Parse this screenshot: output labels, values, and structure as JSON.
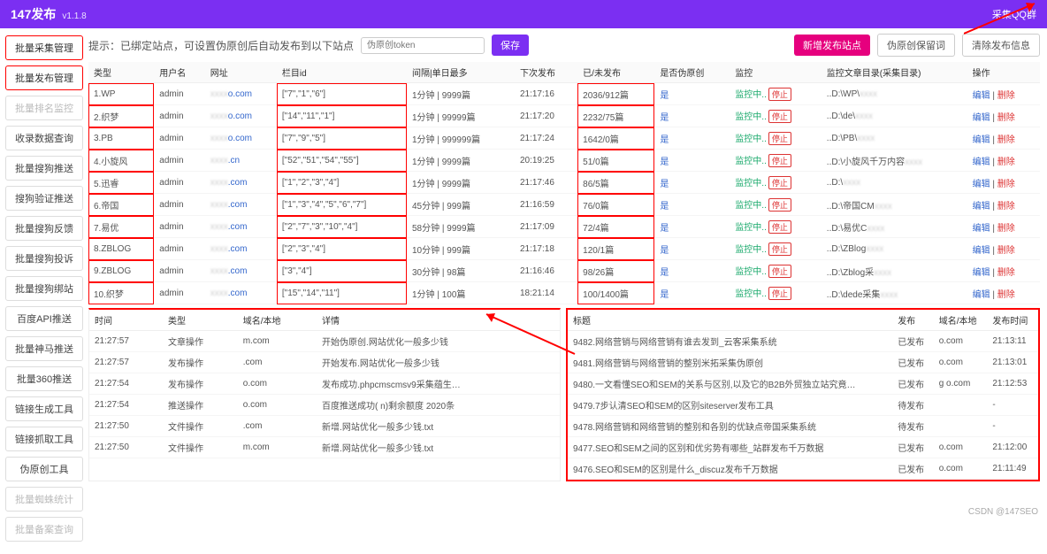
{
  "app": {
    "title": "147发布",
    "version": "v1.1.8",
    "qqgroup": "采集QQ群"
  },
  "sidebar": {
    "items": [
      "批量采集管理",
      "批量发布管理",
      "批量排名监控",
      "收录数据查询",
      "批量搜狗推送",
      "搜狗验证推送",
      "批量搜狗反馈",
      "批量搜狗投诉",
      "批量搜狗绑站",
      "百度API推送",
      "批量神马推送",
      "批量360推送",
      "链接生成工具",
      "链接抓取工具",
      "伪原创工具",
      "批量蜘蛛统计",
      "批量备案查询"
    ]
  },
  "tip": "提示：已绑定站点，可设置伪原创后自动发布到以下站点",
  "token_ph": "伪原创token",
  "buttons": {
    "save": "保存",
    "add": "新增发布站点",
    "fake": "伪原创保留词",
    "clear": "清除发布信息"
  },
  "cols": [
    "类型",
    "用户名",
    "网址",
    "栏目id",
    "间隔|单日最多",
    "下次发布",
    "已/未发布",
    "是否伪原创",
    "监控",
    "监控文章目录(采集目录)",
    "操作"
  ],
  "rows": [
    {
      "t": "1.WP",
      "u": "admin",
      "w": "o.com",
      "c": "[\"7\",\"1\",\"6\"]",
      "iv": "1分钟 | 9999篇",
      "nx": "21:17:16",
      "pu": "2036/912篇",
      "f": "是",
      "m": "监控中",
      "s": "停止",
      "d": "..D:\\WP\\",
      "e": "编辑",
      "del": "删除"
    },
    {
      "t": "2.织梦",
      "u": "admin",
      "w": "o.com",
      "c": "[\"14\",\"11\",\"1\"]",
      "iv": "1分钟 | 99999篇",
      "nx": "21:17:20",
      "pu": "2232/75篇",
      "f": "是",
      "m": "监控中",
      "s": "停止",
      "d": "..D:\\de\\",
      "e": "编辑",
      "del": "删除"
    },
    {
      "t": "3.PB",
      "u": "admin",
      "w": "o.com",
      "c": "[\"7\",\"9\",\"5\"]",
      "iv": "1分钟 | 999999篇",
      "nx": "21:17:24",
      "pu": "1642/0篇",
      "f": "是",
      "m": "监控中",
      "s": "停止",
      "d": "..D:\\PB\\",
      "e": "编辑",
      "del": "删除"
    },
    {
      "t": "4.小旋风",
      "u": "admin",
      "w": ".cn",
      "c": "[\"52\",\"51\",\"54\",\"55\"]",
      "iv": "1分钟 | 9999篇",
      "nx": "20:19:25",
      "pu": "51/0篇",
      "f": "是",
      "m": "监控中",
      "s": "停止",
      "d": "..D:\\小旋风千万内容",
      "e": "编辑",
      "del": "删除"
    },
    {
      "t": "5.迅睿",
      "u": "admin",
      "w": ".com",
      "c": "[\"1\",\"2\",\"3\",\"4\"]",
      "iv": "1分钟 | 9999篇",
      "nx": "21:17:46",
      "pu": "86/5篇",
      "f": "是",
      "m": "监控中",
      "s": "停止",
      "d": "..D:\\",
      "e": "编辑",
      "del": "删除"
    },
    {
      "t": "6.帝国",
      "u": "admin",
      "w": ".com",
      "c": "[\"1\",\"3\",\"4\",\"5\",\"6\",\"7\"]",
      "iv": "45分钟 | 999篇",
      "nx": "21:16:59",
      "pu": "76/0篇",
      "f": "是",
      "m": "监控中",
      "s": "停止",
      "d": "..D:\\帝国CM",
      "e": "编辑",
      "del": "删除"
    },
    {
      "t": "7.易优",
      "u": "admin",
      "w": ".com",
      "c": "[\"2\",\"7\",\"3\",\"10\",\"4\"]",
      "iv": "58分钟 | 9999篇",
      "nx": "21:17:09",
      "pu": "72/4篇",
      "f": "是",
      "m": "监控中",
      "s": "停止",
      "d": "..D:\\易优C",
      "e": "编辑",
      "del": "删除"
    },
    {
      "t": "8.ZBLOG",
      "u": "admin",
      "w": ".com",
      "c": "[\"2\",\"3\",\"4\"]",
      "iv": "10分钟 | 999篇",
      "nx": "21:17:18",
      "pu": "120/1篇",
      "f": "是",
      "m": "监控中",
      "s": "停止",
      "d": "..D:\\ZBlog",
      "e": "编辑",
      "del": "删除"
    },
    {
      "t": "9.ZBLOG",
      "u": "admin",
      "w": ".com",
      "c": "[\"3\",\"4\"]",
      "iv": "30分钟 | 98篇",
      "nx": "21:16:46",
      "pu": "98/26篇",
      "f": "是",
      "m": "监控中",
      "s": "停止",
      "d": "..D:\\Zblog采",
      "e": "编辑",
      "del": "删除"
    },
    {
      "t": "10.织梦",
      "u": "admin",
      "w": ".com",
      "c": "[\"15\",\"14\",\"11\"]",
      "iv": "1分钟 | 100篇",
      "nx": "18:21:14",
      "pu": "100/1400篇",
      "f": "是",
      "m": "监控中",
      "s": "停止",
      "d": "..D:\\dede采集",
      "e": "编辑",
      "del": "删除"
    }
  ],
  "log1": {
    "cols": [
      "时间",
      "类型",
      "域名/本地",
      "详情"
    ],
    "rows": [
      {
        "a": "21:27:57",
        "b": "文章操作",
        "c": "m.com",
        "d": "开始伪原创.网站优化一般多少钱"
      },
      {
        "a": "21:27:57",
        "b": "发布操作",
        "c": ".com",
        "d": "开始发布.网站优化一般多少钱"
      },
      {
        "a": "21:27:54",
        "b": "发布操作",
        "c": "o.com",
        "d": "发布成功.phpcmscmsv9采集蕴生…"
      },
      {
        "a": "21:27:54",
        "b": "推送操作",
        "c": "o.com",
        "d": "百度推送成功(          n)剩余额度 2020条"
      },
      {
        "a": "21:27:50",
        "b": "文件操作",
        "c": ".com",
        "d": "新增.网站优化一般多少钱.txt"
      },
      {
        "a": "21:27:50",
        "b": "文件操作",
        "c": "m.com",
        "d": "新增.网站优化一般多少钱.txt"
      }
    ]
  },
  "log2": {
    "cols": [
      "标题",
      "发布",
      "域名/本地",
      "发布时间"
    ],
    "rows": [
      {
        "a": "9482.网络营销与网络营销有谁去发到_云客采集系统",
        "b": "已发布",
        "c": "o.com",
        "d": "21:13:11"
      },
      {
        "a": "9481.网络营销与网络营销的整别米拓采集伪原创",
        "b": "已发布",
        "c": "o.com",
        "d": "21:13:01"
      },
      {
        "a": "9480.一文看懂SEO和SEM的关系与区别,以及它的B2B外贸独立站究竟…",
        "b": "已发布",
        "c": "g            o.com",
        "d": "21:12:53"
      },
      {
        "a": "9479.7步认清SEO和SEM的区别siteserver发布工具",
        "b": "待发布",
        "c": "",
        "d": "-"
      },
      {
        "a": "9478.网络营销和网络营销的整别和各别的优缺点帝国采集系统",
        "b": "待发布",
        "c": "",
        "d": "-"
      },
      {
        "a": "9477.SEO和SEM之间的区别和优劣势有哪些_站群发布千万数据",
        "b": "已发布",
        "c": "o.com",
        "d": "21:12:00"
      },
      {
        "a": "9476.SEO和SEM的区别是什么_discuz发布千万数据",
        "b": "已发布",
        "c": "o.com",
        "d": "21:11:49"
      }
    ]
  },
  "watermark": "CSDN @147SEO"
}
